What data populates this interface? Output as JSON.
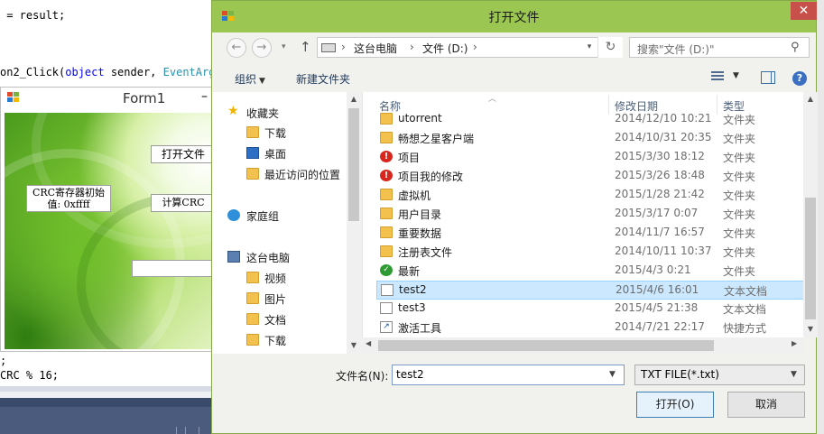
{
  "code_editor": {
    "line1": " = result;",
    "line2_prefix": "on2_Click(",
    "line2_kw": "object",
    "line2_mid": " sender, ",
    "line2_type": "EventArgs",
    "line3": ";",
    "line4": "CRC % 16;"
  },
  "form1": {
    "title": "Form1",
    "minimize": "–",
    "open_file_button": "打开文件",
    "crc_init_label_line1": "CRC寄存器初始",
    "crc_init_label_line2": "值: 0xffff",
    "calc_crc_button": "计算CRC"
  },
  "dialog": {
    "title": "打开文件",
    "close": "✕",
    "address": {
      "segments": [
        "这台电脑",
        "文件 (D:)"
      ],
      "separator": "›"
    },
    "search_placeholder": "搜索\"文件 (D:)\"",
    "toolbar": {
      "organize": "组织",
      "new_folder": "新建文件夹"
    },
    "nav_pane": [
      {
        "label": "收藏夹",
        "icon": "star-icon"
      },
      {
        "label": "下载",
        "icon": "downloads-folder-icon"
      },
      {
        "label": "桌面",
        "icon": "desktop-icon"
      },
      {
        "label": "最近访问的位置",
        "icon": "recent-places-icon"
      },
      {
        "label": "家庭组",
        "icon": "homegroup-icon"
      },
      {
        "label": "这台电脑",
        "icon": "computer-icon"
      },
      {
        "label": "视频",
        "icon": "videos-folder-icon"
      },
      {
        "label": "图片",
        "icon": "pictures-folder-icon"
      },
      {
        "label": "文档",
        "icon": "documents-folder-icon"
      },
      {
        "label": "下载",
        "icon": "downloads-folder-icon"
      }
    ],
    "columns": {
      "name": "名称",
      "date": "修改日期",
      "type": "类型"
    },
    "files": [
      {
        "name": "utorrent",
        "date": "2014/12/10 10:21",
        "type": "文件夹",
        "icon": "folder"
      },
      {
        "name": "畅想之星客户端",
        "date": "2014/10/31 20:35",
        "type": "文件夹",
        "icon": "folder"
      },
      {
        "name": "项目",
        "date": "2015/3/30 18:12",
        "type": "文件夹",
        "icon": "warn"
      },
      {
        "name": "项目我的修改",
        "date": "2015/3/26 18:48",
        "type": "文件夹",
        "icon": "warn"
      },
      {
        "name": "虚拟机",
        "date": "2015/1/28 21:42",
        "type": "文件夹",
        "icon": "folder"
      },
      {
        "name": "用户目录",
        "date": "2015/3/17 0:07",
        "type": "文件夹",
        "icon": "folder"
      },
      {
        "name": "重要数据",
        "date": "2014/11/7 16:57",
        "type": "文件夹",
        "icon": "folder"
      },
      {
        "name": "注册表文件",
        "date": "2014/10/11 10:37",
        "type": "文件夹",
        "icon": "folder"
      },
      {
        "name": "最新",
        "date": "2015/4/3 0:21",
        "type": "文件夹",
        "icon": "ok"
      },
      {
        "name": "test2",
        "date": "2015/4/6 16:01",
        "type": "文本文档",
        "icon": "doc",
        "selected": true
      },
      {
        "name": "test3",
        "date": "2015/4/5 21:38",
        "type": "文本文档",
        "icon": "doc"
      },
      {
        "name": "激活工具",
        "date": "2014/7/21 22:17",
        "type": "快捷方式",
        "icon": "shortcut"
      }
    ],
    "filename_label": "文件名(N):",
    "filename_value": "test2",
    "filetype_value": "TXT FILE(*.txt)",
    "open_button": "打开(O)",
    "cancel_button": "取消"
  },
  "colors": {
    "titlebar": "#9ac651",
    "close": "#c7504a",
    "selection": "#cce8ff",
    "folder": "#f2c14e"
  }
}
